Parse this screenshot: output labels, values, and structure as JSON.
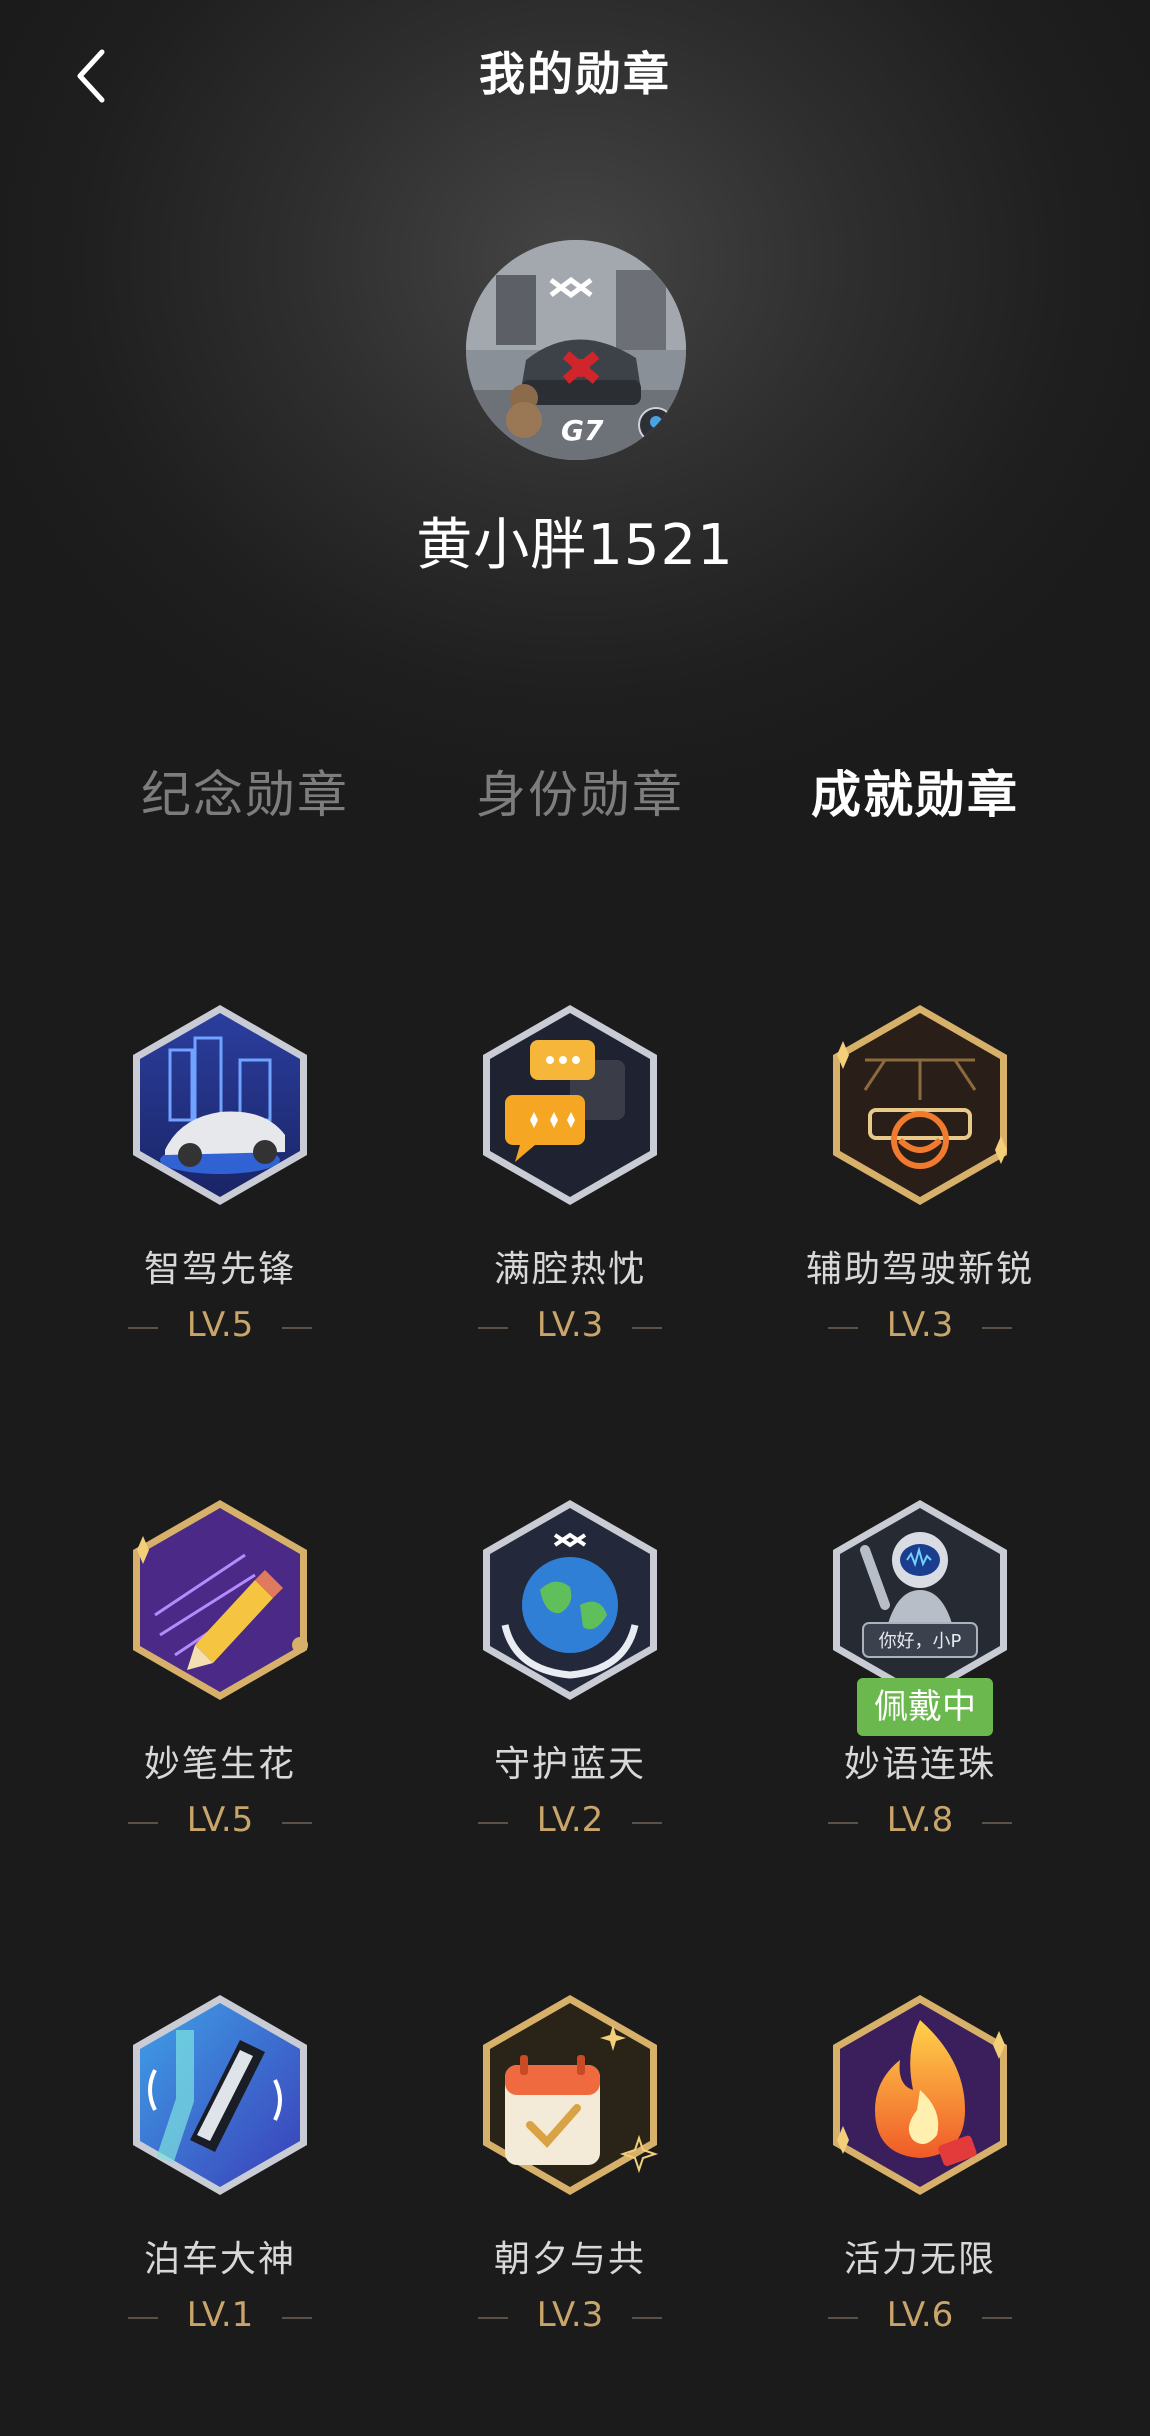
{
  "header": {
    "title": "我的勋章",
    "back_icon": "chevron-left-icon"
  },
  "profile": {
    "username": "黄小胖1521",
    "avatar_text": "G7"
  },
  "tabs": [
    {
      "label": "纪念勋章",
      "active": false
    },
    {
      "label": "身份勋章",
      "active": false
    },
    {
      "label": "成就勋章",
      "active": true
    }
  ],
  "badges": [
    {
      "name": "智驾先锋",
      "level": "LV.5",
      "icon": "city-car-badge-icon"
    },
    {
      "name": "满腔热忱",
      "level": "LV.3",
      "icon": "chat-bubbles-badge-icon"
    },
    {
      "name": "辅助驾驶新锐",
      "level": "LV.3",
      "icon": "steering-wheel-badge-icon"
    },
    {
      "name": "妙笔生花",
      "level": "LV.5",
      "icon": "pencil-badge-icon"
    },
    {
      "name": "守护蓝天",
      "level": "LV.2",
      "icon": "earth-badge-icon"
    },
    {
      "name": "妙语连珠",
      "level": "LV.8",
      "icon": "robot-badge-icon",
      "tag": "佩戴中",
      "robot_text": "你好，小P"
    },
    {
      "name": "泊车大神",
      "level": "LV.1",
      "icon": "parking-badge-icon"
    },
    {
      "name": "朝夕与共",
      "level": "LV.3",
      "icon": "calendar-badge-icon"
    },
    {
      "name": "活力无限",
      "level": "LV.6",
      "icon": "flame-badge-icon"
    }
  ],
  "colors": {
    "level_gold": "#c9a56b",
    "wearing_green": "#6bb84f",
    "inactive_tab": "#7d7d7d"
  }
}
